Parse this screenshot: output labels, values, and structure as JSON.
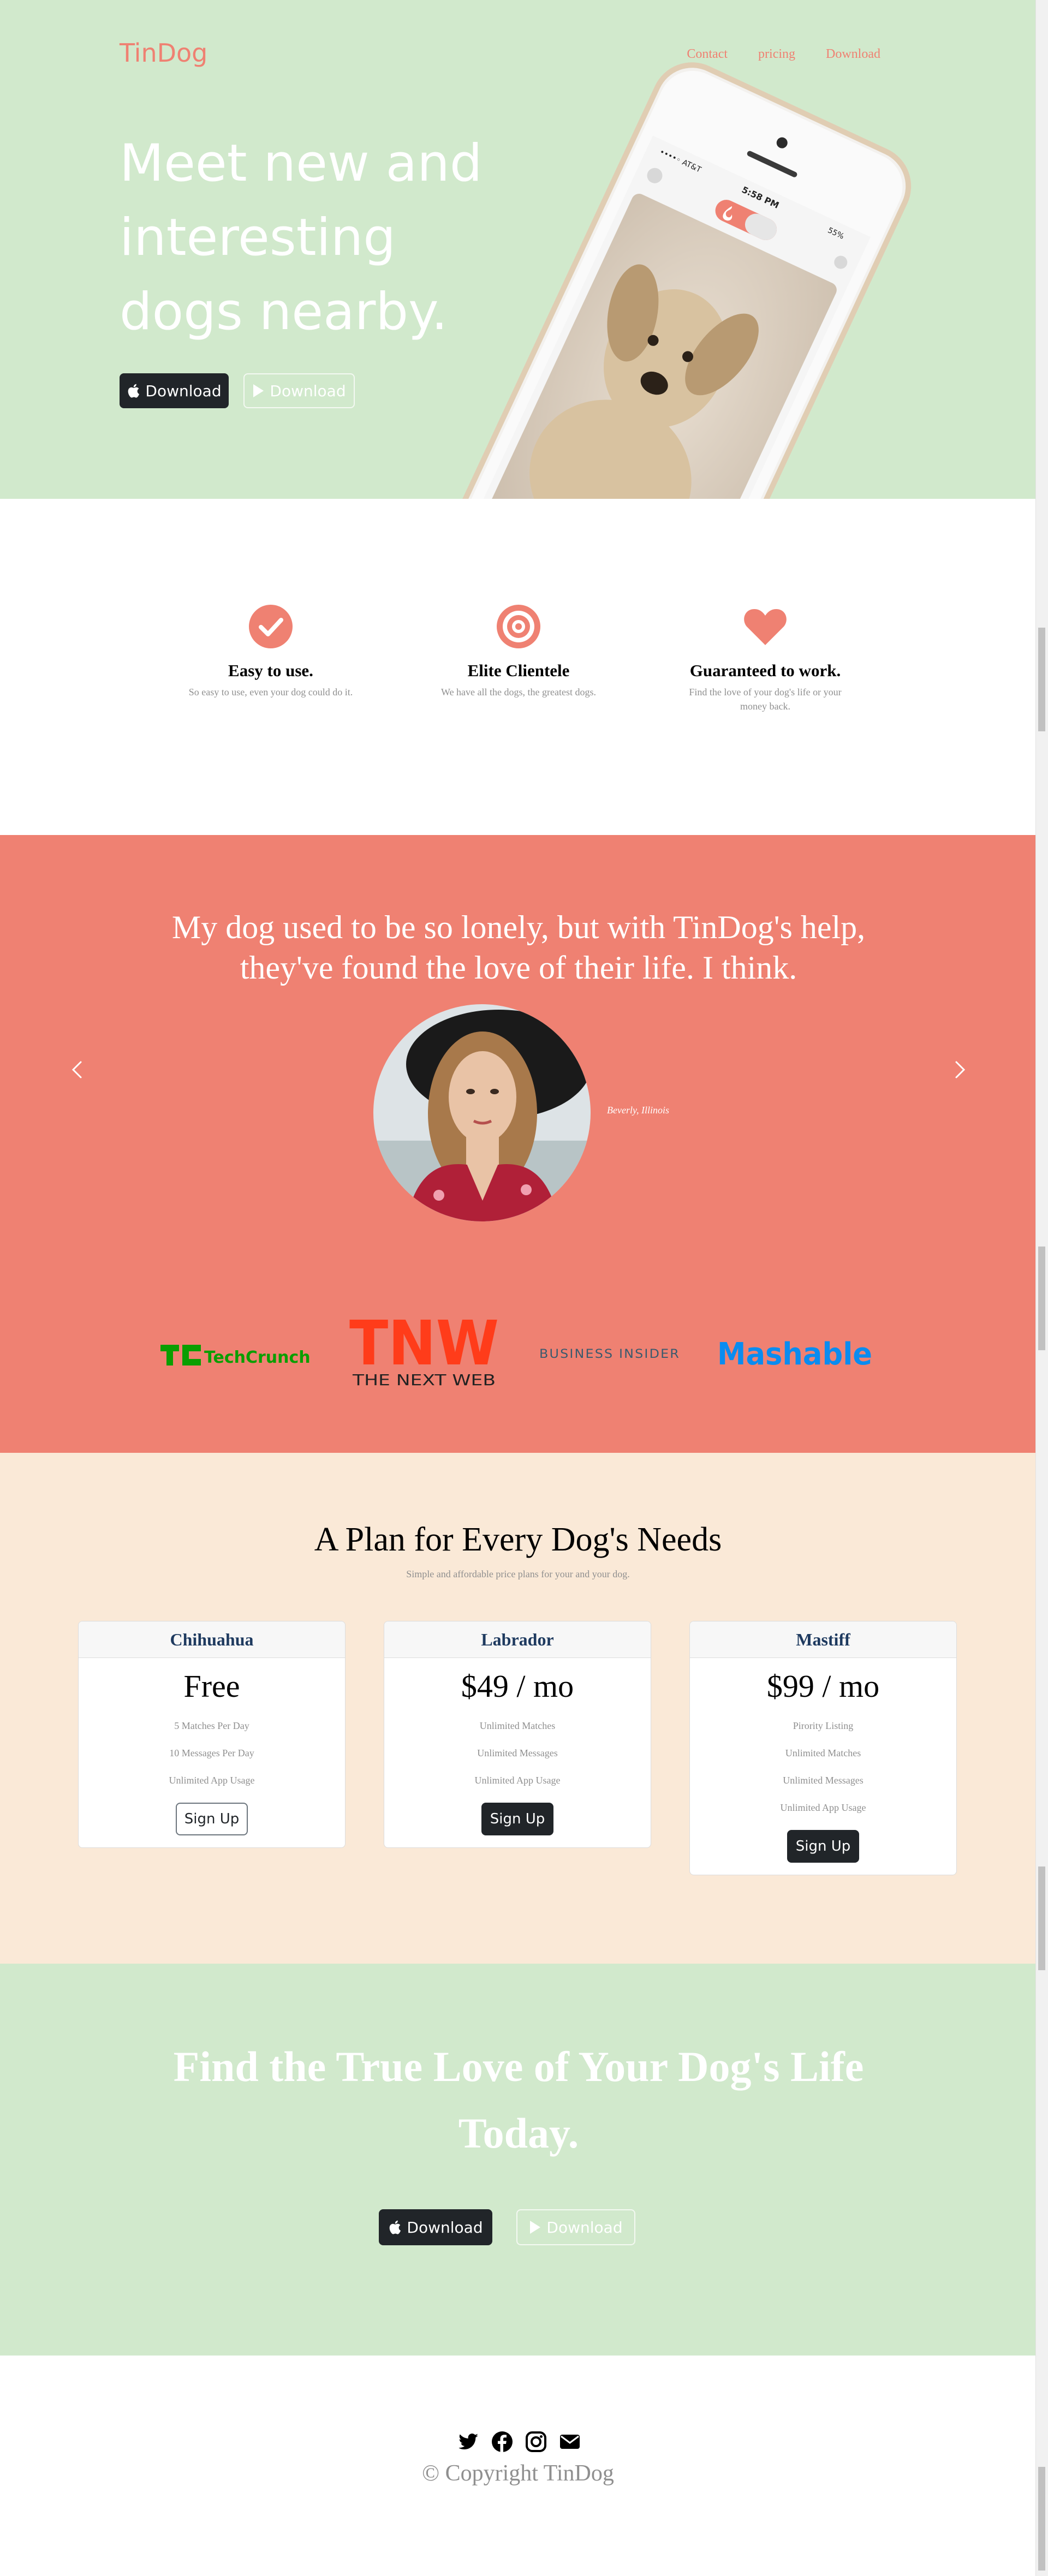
{
  "brand": "TinDog",
  "nav": {
    "contact": "Contact",
    "pricing": "pricing",
    "download": "Download"
  },
  "hero": {
    "title": "Meet new and interesting dogs nearby.",
    "download_apple": "Download",
    "download_google": "Download",
    "phone": {
      "status": "5:58 PM",
      "carrier": "••••◦ AT&T",
      "battery": "55%"
    }
  },
  "features": [
    {
      "icon": "check-circle-icon",
      "title": "Easy to use.",
      "text": "So easy to use, even your dog could do it."
    },
    {
      "icon": "bullseye-icon",
      "title": "Elite Clientele",
      "text": "We have all the dogs, the greatest dogs."
    },
    {
      "icon": "heart-icon",
      "title": "Guaranteed to work.",
      "text": "Find the love of your dog's life or your money back."
    }
  ],
  "testimonial": {
    "quote": "My dog used to be so lonely, but with TinDog's help, they've found the love of their life. I think.",
    "caption": "Beverly, Illinois"
  },
  "press": {
    "techcrunch": "TechCrunch",
    "tnw_mark": "TNW",
    "tnw_text": "THE NEXT WEB",
    "business_insider": "BUSINESS INSIDER",
    "mashable": "Mashable"
  },
  "pricing": {
    "title": "A Plan for Every Dog's Needs",
    "subtitle": "Simple and affordable price plans for your and your dog.",
    "plans": [
      {
        "name": "Chihuahua",
        "price": "Free",
        "features": [
          "5 Matches Per Day",
          "10 Messages Per Day",
          "Unlimited App Usage"
        ],
        "button": "Sign Up"
      },
      {
        "name": "Labrador",
        "price": "$49 / mo",
        "features": [
          "Unlimited Matches",
          "Unlimited Messages",
          "Unlimited App Usage"
        ],
        "button": "Sign Up"
      },
      {
        "name": "Mastiff",
        "price": "$99 / mo",
        "features": [
          "Pirority Listing",
          "Unlimited Matches",
          "Unlimited Messages",
          "Unlimited App Usage"
        ],
        "button": "Sign Up"
      }
    ]
  },
  "cta": {
    "title": "Find the True Love of Your Dog's Life Today.",
    "download_apple": "Download",
    "download_google": "Download"
  },
  "footer": {
    "copyright": "© Copyright TinDog"
  },
  "colors": {
    "green": "#d1e9cc",
    "coral": "#ef8172",
    "cream": "#fae9d7",
    "dark": "#212529",
    "gray_text": "#8f8f8f"
  }
}
